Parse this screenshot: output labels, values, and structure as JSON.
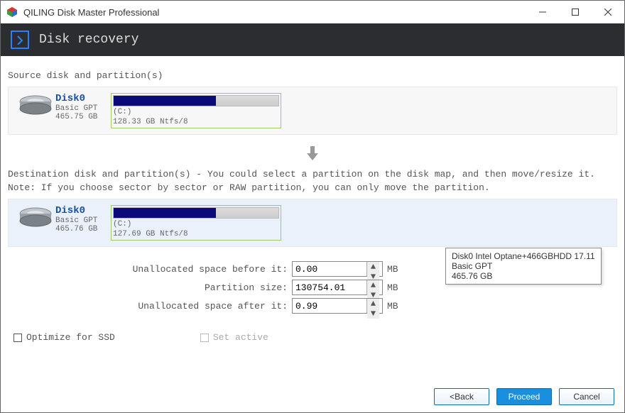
{
  "window": {
    "title": "QILING Disk Master Professional"
  },
  "header": {
    "title": "Disk recovery"
  },
  "source": {
    "label": "Source disk and partition(s)",
    "disk": {
      "name": "Disk0",
      "type": "Basic GPT",
      "size": "465.75 GB"
    },
    "part": {
      "letter": "(C:)",
      "desc": "128.33 GB Ntfs/8",
      "fill_pct": 62
    }
  },
  "dest": {
    "label": "Destination disk and partition(s) - You could select a partition on the disk map, and then move/resize it.",
    "note": "Note: If you choose sector by sector or RAW partition, you can only move the partition.",
    "disk": {
      "name": "Disk0",
      "type": "Basic GPT",
      "size": "465.76 GB"
    },
    "part": {
      "letter": "(C:)",
      "desc": "127.69 GB Ntfs/8",
      "fill_pct": 62
    }
  },
  "tooltip": {
    "line1": "Disk0 Intel Optane+466GBHDD 17.11",
    "line2": "Basic GPT",
    "line3": "465.76 GB"
  },
  "fields": {
    "before": {
      "label": "Unallocated space before it:",
      "value": "0.00",
      "unit": "MB"
    },
    "size": {
      "label": "Partition size:",
      "value": "130754.01",
      "unit": "MB"
    },
    "after": {
      "label": "Unallocated space after it:",
      "value": "0.99",
      "unit": "MB"
    }
  },
  "options": {
    "ssd": "Optimize for SSD",
    "active": "Set active"
  },
  "buttons": {
    "back": "<Back",
    "proceed": "Proceed",
    "cancel": "Cancel"
  }
}
